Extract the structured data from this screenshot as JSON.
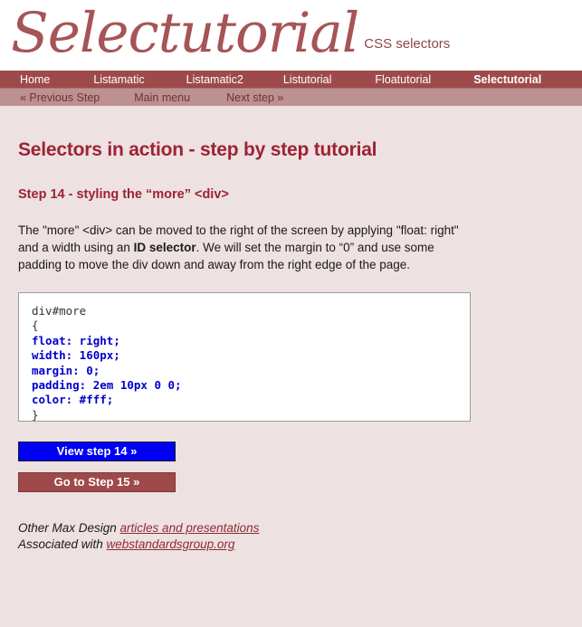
{
  "site": {
    "logo_text": "Selectutorial",
    "tagline": "CSS selectors"
  },
  "mainnav": {
    "items": [
      {
        "label": "Home",
        "active": false
      },
      {
        "label": "Listamatic",
        "active": false
      },
      {
        "label": "Listamatic2",
        "active": false
      },
      {
        "label": "Listutorial",
        "active": false
      },
      {
        "label": "Floatutorial",
        "active": false
      },
      {
        "label": "Selectutorial",
        "active": true
      }
    ]
  },
  "subnav": {
    "items": [
      {
        "label": "« Previous Step"
      },
      {
        "label": "Main menu"
      },
      {
        "label": "Next step »"
      }
    ]
  },
  "main": {
    "page_title": "Selectors in action - step by step tutorial",
    "step_title": "Step 14 - styling the “more” <div>",
    "paragraph_part1": "The \"more\" <div> can be moved to the right of the screen by applying \"float: right\" and a width using an ",
    "paragraph_bold": "ID selector",
    "paragraph_part2": ". We will set the margin to “0” and use some padding to move the div down and away from the right edge of the page.",
    "code": {
      "selector": "div#more",
      "open_brace": "{",
      "declarations": [
        "float: right;",
        "width: 160px;",
        "margin: 0;",
        "padding: 2em 10px 0 0;",
        "color: #fff;"
      ],
      "close_brace": "}"
    },
    "buttons": {
      "view_step": "View step 14 »",
      "go_to_step": "Go to Step 15 »"
    }
  },
  "footer": {
    "line1_prefix": "Other Max Design ",
    "line1_link": "articles and presentations",
    "line2_prefix": "Associated with ",
    "line2_link": "webstandardsgroup.org"
  },
  "colors": {
    "page_bg": "#ede1e1",
    "nav_bg": "#9e4a4a",
    "subnav_bg": "#bd9192",
    "heading": "#9d2235",
    "code_prop": "#0000cc",
    "btn_view_bg": "#0000f5",
    "btn_next_bg": "#9e4a4a",
    "link": "#8f2b36"
  }
}
